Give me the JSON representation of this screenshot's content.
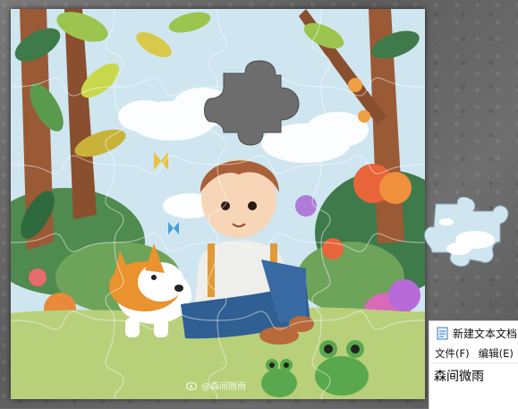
{
  "puzzle": {
    "pieces_total": 20,
    "pieces_missing": 1,
    "artwork": "forest-boy-corgi-frogs"
  },
  "watermark": {
    "text": "@森间微雨"
  },
  "notepad": {
    "window_title": "新建文本文档",
    "menu": [
      "文件(F)",
      "编辑(E)"
    ],
    "content": "森间微雨"
  },
  "colors": {
    "sky": "#cfe6f0",
    "leaf_dark": "#3f7a4a",
    "leaf_light": "#9cc54f",
    "trunk": "#9a5a36",
    "corgi": "#e9922e",
    "jeans": "#2f5f93",
    "frog": "#5aa84d",
    "stone": "#6b6b6b"
  }
}
